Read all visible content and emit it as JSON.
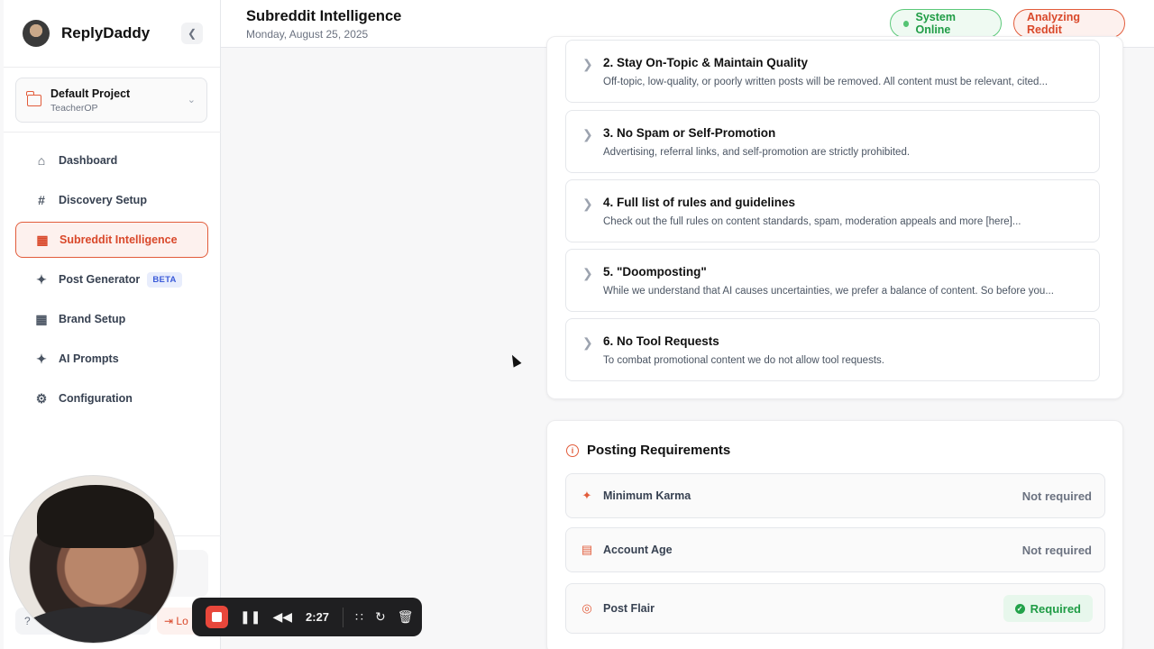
{
  "sidebar": {
    "brand": "ReplyDaddy",
    "project": {
      "name": "Default Project",
      "sub": "TeacherOP"
    },
    "nav": [
      {
        "label": "Dashboard",
        "icon": "home-icon"
      },
      {
        "label": "Discovery Setup",
        "icon": "hash-icon"
      },
      {
        "label": "Subreddit Intelligence",
        "icon": "bar-chart-icon",
        "active": true
      },
      {
        "label": "Post Generator",
        "icon": "sparkles-icon",
        "badge": "BETA"
      },
      {
        "label": "Brand Setup",
        "icon": "building-icon"
      },
      {
        "label": "AI Prompts",
        "icon": "sparkles-icon"
      },
      {
        "label": "Configuration",
        "icon": "gear-icon"
      }
    ],
    "logout_label": "Lo"
  },
  "header": {
    "title": "Subreddit Intelligence",
    "date": "Monday, August 25, 2025",
    "status_online": "System Online",
    "status_analyzing": "Analyzing Reddit"
  },
  "rules": [
    {
      "title": "2. Stay On-Topic & Maintain Quality",
      "desc": "Off-topic, low-quality, or poorly written posts will be removed. All content must be relevant, cited..."
    },
    {
      "title": "3. No Spam or Self-Promotion",
      "desc": "Advertising, referral links, and self-promotion are strictly prohibited."
    },
    {
      "title": "4. Full list of rules and guidelines",
      "desc": "Check out the full rules on content standards, spam, moderation appeals and more [here]..."
    },
    {
      "title": "5. \"Doomposting\"",
      "desc": "While we understand that AI causes uncertainties, we prefer a balance of content. So before you..."
    },
    {
      "title": "6. No Tool Requests",
      "desc": "To combat promotional content we do not allow tool requests."
    }
  ],
  "requirements": {
    "title": "Posting Requirements",
    "items": [
      {
        "label": "Minimum Karma",
        "value": "Not required",
        "icon": "sparkles-icon"
      },
      {
        "label": "Account Age",
        "value": "Not required",
        "icon": "calendar-icon"
      },
      {
        "label": "Post Flair",
        "value": "Required",
        "icon": "globe-icon"
      }
    ]
  },
  "recorder": {
    "time": "2:27"
  },
  "colors": {
    "accent": "#e25c3b",
    "success": "#1f9c45"
  }
}
